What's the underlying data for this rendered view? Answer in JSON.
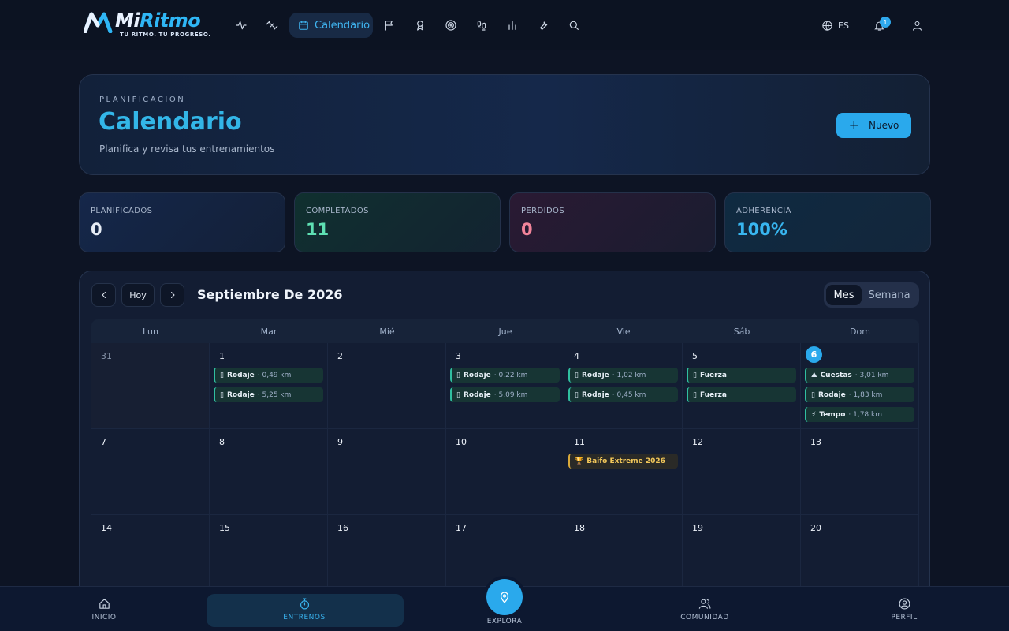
{
  "brand": {
    "name_a": "Mi",
    "name_b": "Ritmo",
    "tagline": "TU RITMO. TU PROGRESO."
  },
  "nav": {
    "active_label": "Calendario",
    "icons": [
      "activity-icon",
      "dumbbell-icon",
      "calendar-icon",
      "flag-icon",
      "award-icon",
      "target-icon",
      "footprints-icon",
      "bar-chart-icon",
      "wrench-icon",
      "search-icon"
    ]
  },
  "top": {
    "lang": "ES",
    "notifications": "1"
  },
  "hero": {
    "eyebrow": "PLANIFICACIÓN",
    "title": "Calendario",
    "subtitle": "Planifica y revisa tus entrenamientos",
    "new_label": "Nuevo"
  },
  "stats": [
    {
      "label": "PLANIFICADOS",
      "value": "0",
      "color": "#e6ecf5"
    },
    {
      "label": "COMPLETADOS",
      "value": "11",
      "color": "#5ee0b3"
    },
    {
      "label": "PERDIDOS",
      "value": "0",
      "color": "#f2849a"
    },
    {
      "label": "ADHERENCIA",
      "value": "100%",
      "color": "#38b6f0"
    }
  ],
  "calendar": {
    "today_label": "Hoy",
    "month_title": "Septiembre De 2026",
    "view_month": "Mes",
    "view_week": "Semana",
    "weekdays": [
      "Lun",
      "Mar",
      "Mié",
      "Jue",
      "Vie",
      "Sáb",
      "Dom"
    ],
    "weeks": [
      [
        {
          "n": "31",
          "muted": true,
          "events": []
        },
        {
          "n": "1",
          "events": [
            {
              "icon": "▯",
              "name": "Rodaje",
              "detail": "· 0,49 km"
            },
            {
              "icon": "▯",
              "name": "Rodaje",
              "detail": "· 5,25 km"
            }
          ]
        },
        {
          "n": "2",
          "events": []
        },
        {
          "n": "3",
          "events": [
            {
              "icon": "▯",
              "name": "Rodaje",
              "detail": "· 0,22 km"
            },
            {
              "icon": "▯",
              "name": "Rodaje",
              "detail": "· 5,09 km"
            }
          ]
        },
        {
          "n": "4",
          "events": [
            {
              "icon": "▯",
              "name": "Rodaje",
              "detail": "· 1,02 km"
            },
            {
              "icon": "▯",
              "name": "Rodaje",
              "detail": "· 0,45 km"
            }
          ]
        },
        {
          "n": "5",
          "events": [
            {
              "icon": "▯",
              "name": "Fuerza",
              "detail": ""
            },
            {
              "icon": "▯",
              "name": "Fuerza",
              "detail": ""
            }
          ]
        },
        {
          "n": "6",
          "today": true,
          "events": [
            {
              "icon": "⛰",
              "name": "Cuestas",
              "detail": "· 3,01 km"
            },
            {
              "icon": "▯",
              "name": "Rodaje",
              "detail": "· 1,83 km"
            },
            {
              "icon": "⚡",
              "name": "Tempo",
              "detail": "· 1,78 km"
            }
          ]
        }
      ],
      [
        {
          "n": "7",
          "events": []
        },
        {
          "n": "8",
          "events": []
        },
        {
          "n": "9",
          "events": []
        },
        {
          "n": "10",
          "events": []
        },
        {
          "n": "11",
          "events": [
            {
              "icon": "🏆",
              "name": "Baifo Extreme 2026",
              "detail": "",
              "race": true
            }
          ]
        },
        {
          "n": "12",
          "events": []
        },
        {
          "n": "13",
          "events": []
        }
      ],
      [
        {
          "n": "14",
          "events": []
        },
        {
          "n": "15",
          "events": []
        },
        {
          "n": "16",
          "events": []
        },
        {
          "n": "17",
          "events": []
        },
        {
          "n": "18",
          "events": []
        },
        {
          "n": "19",
          "events": []
        },
        {
          "n": "20",
          "events": []
        }
      ]
    ]
  },
  "bottom_nav": {
    "home": "INICIO",
    "workouts": "ENTRENOS",
    "explore": "EXPLORA",
    "community": "COMUNIDAD",
    "profile": "PERFIL"
  }
}
